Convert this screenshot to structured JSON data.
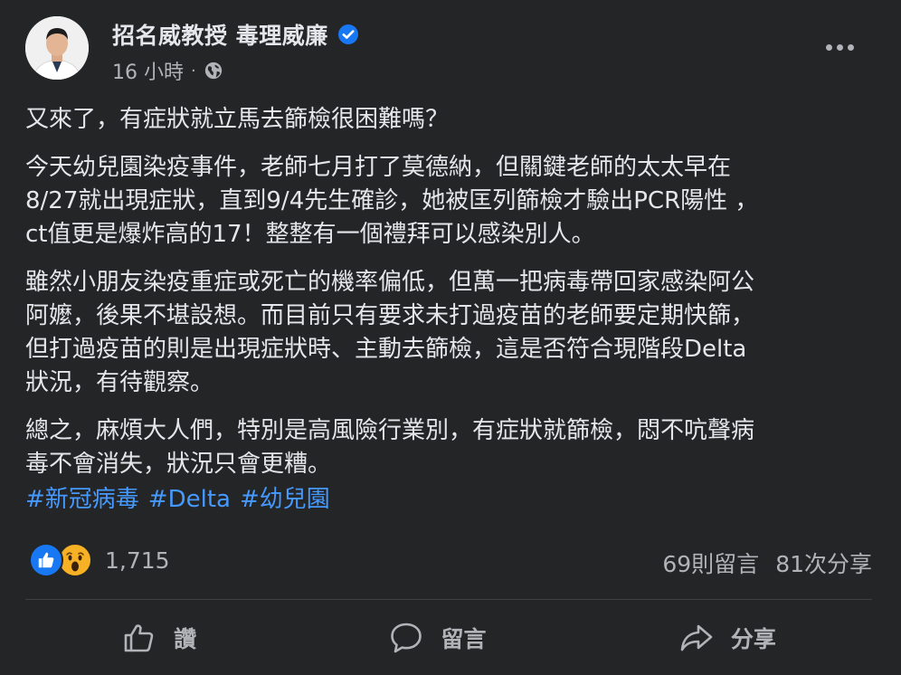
{
  "post": {
    "author": "招名威教授 毒理威廉",
    "verified": true,
    "time": "16 小時",
    "privacy_icon": "globe-icon",
    "more_icon": "more-horizontal-icon",
    "paragraphs": [
      "又來了，有症狀就立馬去篩檢很困難嗎？",
      "今天幼兒園染疫事件，老師七月打了莫德納，但關鍵老師的太太早在\n8/27就出現症狀，直到9/4先生確診，她被匡列篩檢才驗出PCR陽性 ，\nct值更是爆炸高的17！整整有一個禮拜可以感染別人。",
      "雖然小朋友染疫重症或死亡的機率偏低，但萬一把病毒帶回家感染阿公\n阿嬤，後果不堪設想。而目前只有要求未打過疫苗的老師要定期快篩，\n但打過疫苗的則是出現症狀時、主動去篩檢，這是否符合現階段Delta\n狀況，有待觀察。",
      "總之，麻煩大人們，特別是高風險行業別，有症狀就篩檢，悶不吭聲病\n毒不會消失，狀況只會更糟。"
    ],
    "hashtags": [
      "#新冠病毒",
      "#Delta",
      "#幼兒園"
    ]
  },
  "engagement": {
    "reaction_icons": [
      "like-icon",
      "wow-icon"
    ],
    "reaction_count": "1,715",
    "comments": "69則留言",
    "shares": "81次分享"
  },
  "actions": {
    "like": "讚",
    "comment": "留言",
    "share": "分享"
  },
  "colors": {
    "background": "#242526",
    "text": "#e4e6eb",
    "secondary_text": "#b0b3b8",
    "hashtag": "#4599ff",
    "verified": "#1877f2"
  }
}
